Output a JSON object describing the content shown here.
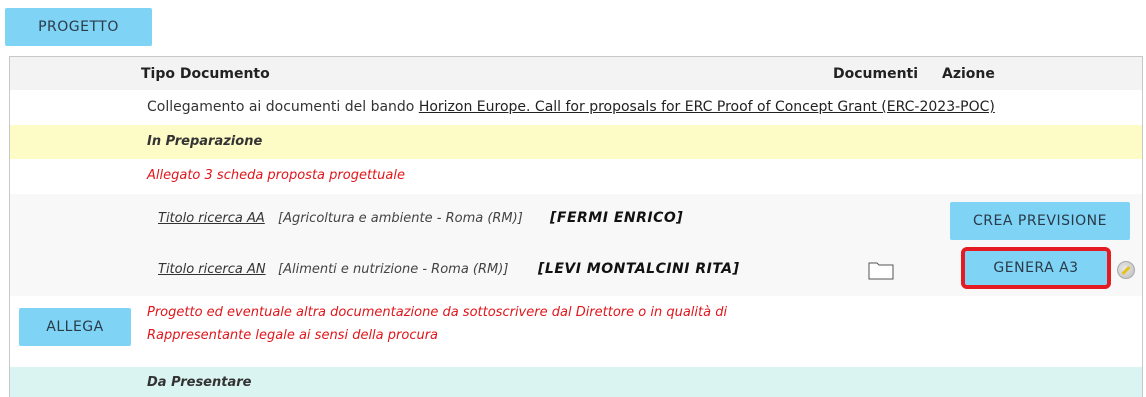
{
  "top": {
    "progetto_label": "PROGETTO"
  },
  "table": {
    "headers": {
      "tipo": "Tipo Documento",
      "documenti": "Documenti",
      "azione": "Azione"
    },
    "link_row": {
      "prefix": "Collegamento ai documenti del bando ",
      "link_text": "Horizon Europe. Call for proposals for ERC Proof of Concept Grant (ERC-2023-POC)"
    },
    "prep_label": "In Preparazione",
    "allegato_label": "Allegato 3 scheda proposta progettuale",
    "rows": [
      {
        "title": "Titolo ricerca AA",
        "desc": "[Agricoltura e ambiente - Roma (RM)]",
        "person": "[FERMI ENRICO]",
        "action": "CREA PREVISIONE"
      },
      {
        "title": "Titolo ricerca AN",
        "desc": "[Alimenti e nutrizione - Roma (RM)]",
        "person": "[LEVI MONTALCINI RITA]",
        "action": "GENERA A3"
      }
    ],
    "project": {
      "allega_label": "ALLEGA",
      "line1": "Progetto ed eventuale altra documentazione da sottoscrivere dal Direttore o in qualità di",
      "line2": "Rappresentante legale ai sensi della procura"
    },
    "da_presentare_label": "Da Presentare"
  },
  "icons": {
    "folder": "folder-icon",
    "pencil": "edit-pencil-icon"
  },
  "colors": {
    "button_bg": "#7fd3f5",
    "highlight_outline": "#e51b23",
    "prep_bg": "#fdfbc6",
    "presentare_bg": "#daf4f1",
    "red_text": "#e0161b"
  }
}
